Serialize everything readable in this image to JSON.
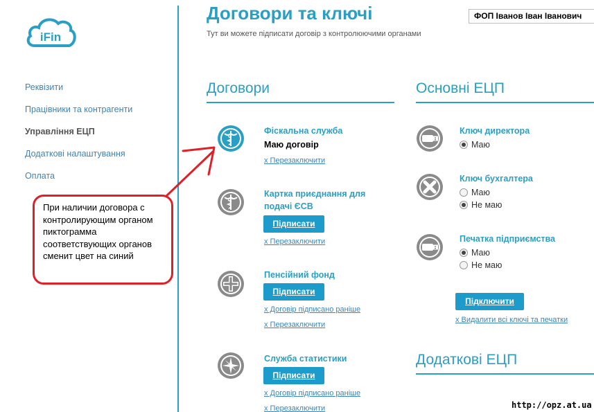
{
  "brand": {
    "logo_text": "iFin",
    "accent": "#2a9fc4"
  },
  "sidebar": {
    "items": [
      {
        "label": "Реквізити",
        "active": false
      },
      {
        "label": "Працівники та контрагенти",
        "active": false
      },
      {
        "label": "Управління ЕЦП",
        "active": true
      },
      {
        "label": "Додаткові налаштування",
        "active": false
      },
      {
        "label": "Оплата",
        "active": false
      }
    ]
  },
  "callout": {
    "text": "При наличии договора с контролирующим органом пиктограмма соответствующих органов сменит цвет на синий",
    "color": "#e01f26"
  },
  "header": {
    "title": "Договори та ключі",
    "subtitle": "Тут ви можете підписати договір з контролюючими органами",
    "user": "ФОП Іванов Іван Іванович"
  },
  "contracts": {
    "title": "Договори",
    "items": [
      {
        "name": "Фіскальна служба",
        "icon": "caduceus-icon",
        "active": true,
        "status": "Маю договір",
        "button": "",
        "links": [
          "х Перезаключити"
        ]
      },
      {
        "name": "Картка приєднання для подачі ЄСВ",
        "icon": "caduceus-icon",
        "active": false,
        "status": "",
        "button": "Підписати",
        "links": [
          "х Перезаключити"
        ]
      },
      {
        "name": "Пенсійний фонд",
        "icon": "cross-icon",
        "active": false,
        "status": "",
        "button": "Підписати",
        "links": [
          "х Договір підписано раніше",
          "х Перезаключити"
        ]
      },
      {
        "name": "Служба статистики",
        "icon": "compass-icon",
        "active": false,
        "status": "",
        "button": "Підписати",
        "links": [
          "х Договір підписано раніше",
          "х Перезаключити"
        ]
      }
    ]
  },
  "keys": {
    "title": "Основні ЕЦП",
    "items": [
      {
        "name": "Ключ директора",
        "icon": "usb-key-icon",
        "options": [
          "Маю"
        ],
        "selected": "Маю"
      },
      {
        "name": "Ключ бухгалтера",
        "icon": "no-key-icon",
        "options": [
          "Маю",
          "Не маю"
        ],
        "selected": "Не маю"
      },
      {
        "name": "Печатка підприємства",
        "icon": "usb-key-icon",
        "options": [
          "Маю",
          "Не маю"
        ],
        "selected": "Маю"
      }
    ],
    "connect_button": "Підключити",
    "delete_link": "х Видалити всі ключі та печатки"
  },
  "extra_keys": {
    "title": "Додаткові ЕЦП"
  },
  "watermark": "http://opz.at.ua"
}
